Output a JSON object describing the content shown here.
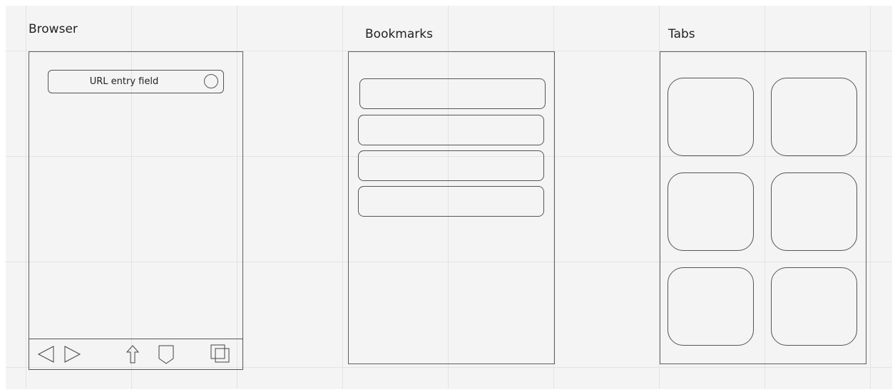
{
  "frames": {
    "browser": {
      "title": "Browser",
      "url_field": {
        "label": "URL entry field"
      },
      "toolbar": {
        "icons": [
          "back-icon",
          "forward-icon",
          "share-icon",
          "bookmark-icon",
          "tabs-icon"
        ]
      }
    },
    "bookmarks": {
      "title": "Bookmarks",
      "row_count": 4
    },
    "tabs": {
      "title": "Tabs",
      "card_count": 6
    }
  }
}
